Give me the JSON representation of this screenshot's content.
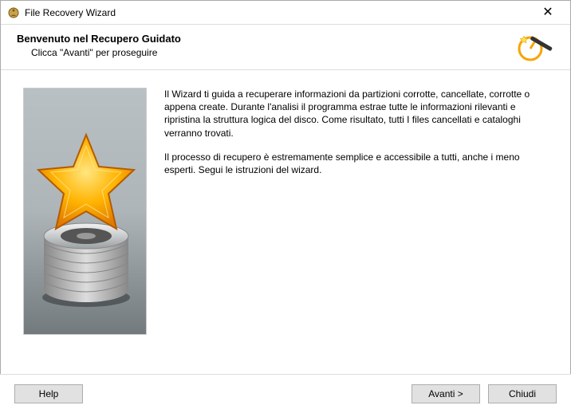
{
  "window": {
    "title": "File Recovery Wizard"
  },
  "header": {
    "title": "Benvenuto nel Recupero Guidato",
    "subtitle": "Clicca \"Avanti\" per proseguire"
  },
  "body": {
    "p1": "Il Wizard ti guida a recuperare informazioni da partizioni corrotte, cancellate, corrotte o appena create. Durante l'analisi il programma estrae tutte le informazioni rilevanti e ripristina la struttura logica del disco. Come risultato, tutti I files cancellati e cataloghi verranno trovati.",
    "p2": "Il processo di recupero è estremamente semplice e accessibile a tutti, anche i meno esperti. Segui le istruzioni del wizard."
  },
  "buttons": {
    "help": "Help",
    "next": "Avanti >",
    "close": "Chiudi"
  }
}
